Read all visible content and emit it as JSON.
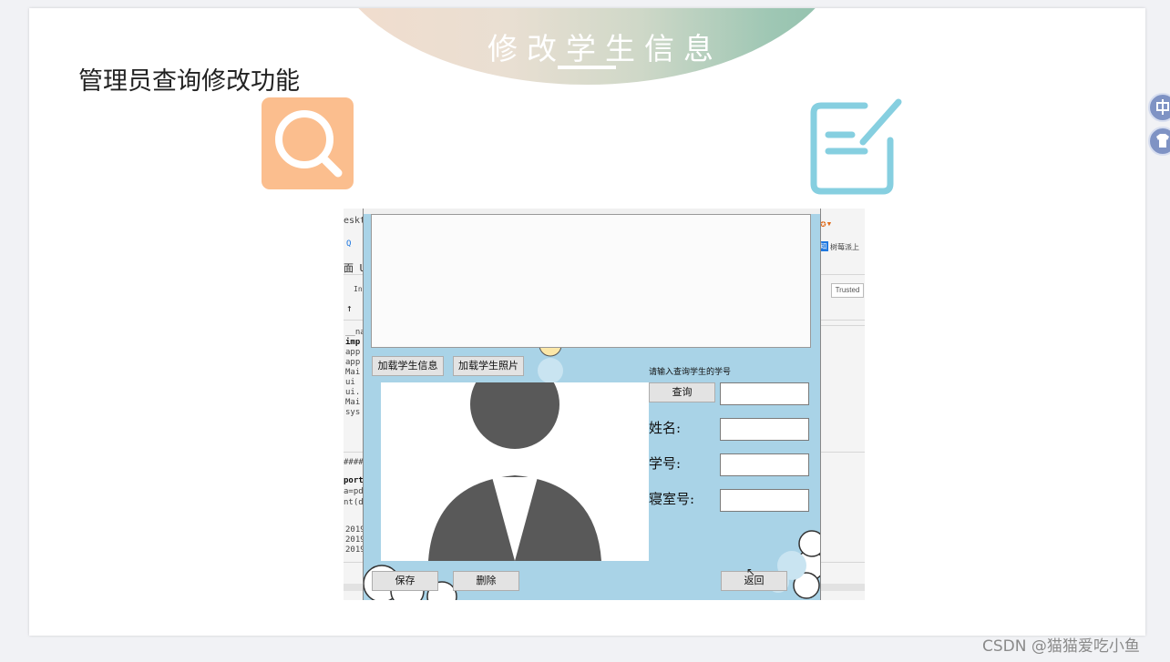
{
  "slide": {
    "banner_title": "修改学生信息",
    "page_title": "管理员查询修改功能"
  },
  "ide": {
    "path_fragment": "eskto",
    "tab_fragment": "面 U",
    "ins_fragment": "Ins",
    "trusted_label": "Trusted",
    "zhi_badge": "知",
    "bookmark_text": "树莓派上",
    "code_lines": [
      "__na",
      "imp",
      "app",
      "app",
      "Mai",
      "ui",
      "ui.",
      "Mai",
      "sys"
    ],
    "code_lines2": [
      "####",
      "port",
      "a=pd.",
      "nt(d"
    ],
    "code_lines3": [
      "2019",
      "2019",
      "2019("
    ]
  },
  "app": {
    "load_info_button": "加载学生信息",
    "load_photo_button": "加载学生照片",
    "query_hint": "请输入查询学生的学号",
    "query_button": "查询",
    "name_label": "姓名:",
    "student_id_label": "学号:",
    "dorm_label": "寝室号:",
    "save_button": "保存",
    "delete_button": "删除",
    "back_button": "返回",
    "query_input_value": "",
    "name_value": "",
    "student_id_value": "",
    "dorm_value": ""
  },
  "footer": {
    "watermark": "CSDN @猫猫爱吃小鱼"
  },
  "colors": {
    "search_tile": "#fbbe8e",
    "edit_icon": "#86cfe0",
    "app_background": "#a9d3e7"
  }
}
